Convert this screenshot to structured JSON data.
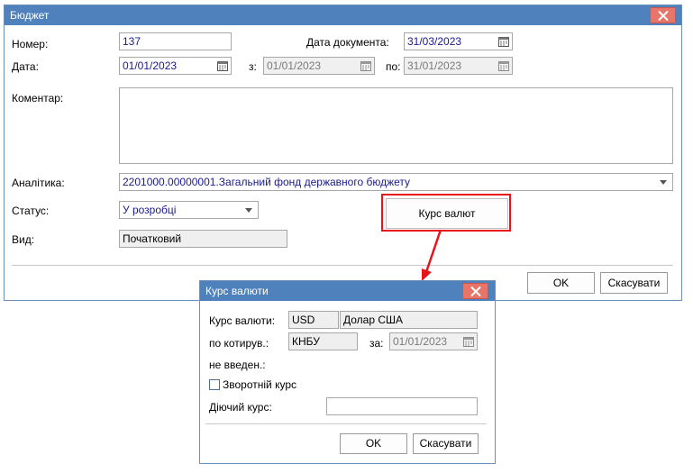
{
  "main": {
    "title": "Бюджет",
    "number_label": "Номер:",
    "number_value": "137",
    "doc_date_label": "Дата документа:",
    "doc_date_value": "31/03/2023",
    "date_label": "Дата:",
    "date_value": "01/01/2023",
    "from_label": "з:",
    "from_value": "01/01/2023",
    "to_label": "по:",
    "to_value": "31/01/2023",
    "comment_label": "Коментар:",
    "comment_value": "",
    "analytics_label": "Аналітика:",
    "analytics_value": "2201000.00000001.Загальний фонд державного бюджету",
    "status_label": "Статус:",
    "status_value": "У розробці",
    "kind_label": "Вид:",
    "kind_value": "Початковий",
    "rates_button": "Курс валют",
    "ok_button": "OK",
    "cancel_button": "Скасувати"
  },
  "dialog": {
    "title": "Курс валюти",
    "currency_label": "Курс валюти:",
    "currency_code": "USD",
    "currency_name": "Долар США",
    "quoted_label": "по котирув.:",
    "quoted_value": "КНБУ",
    "on_label": "за:",
    "on_value": "01/01/2023",
    "not_entered_label": "не введен.:",
    "reverse_label": "Зворотній курс",
    "reverse_checked": false,
    "current_rate_label": "Діючий курс:",
    "current_rate_value": "",
    "ok_button": "OK",
    "cancel_button": "Скасувати"
  },
  "colors": {
    "titlebar": "#4f81bd",
    "close_button": "#e8756a",
    "highlight": "#e8141c",
    "field_text": "#1a1a8c"
  },
  "icons": {
    "close": "close-icon",
    "calendar": "calendar-icon",
    "dropdown": "chevron-down-icon",
    "arrow": "arrow-icon"
  }
}
